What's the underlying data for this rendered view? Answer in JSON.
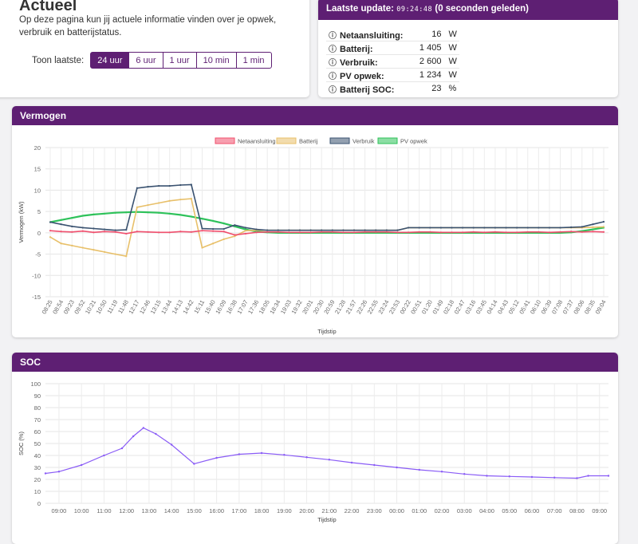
{
  "actueel": {
    "title": "Actueel",
    "intro": "Op deze pagina kun jij actuele informatie vinden over je opwek, verbruik en batterijstatus.",
    "toon_label": "Toon laatste:",
    "buttons": [
      {
        "label": "24 uur",
        "active": true
      },
      {
        "label": "6 uur",
        "active": false
      },
      {
        "label": "1 uur",
        "active": false
      },
      {
        "label": "10 min",
        "active": false
      },
      {
        "label": "1 min",
        "active": false
      }
    ]
  },
  "update": {
    "label": "Laatste update:",
    "time": "09:24:48",
    "ago": "(0 seconden geleden)",
    "rows": [
      {
        "label": "Netaansluiting:",
        "value": "16",
        "unit": "W"
      },
      {
        "label": "Batterij:",
        "value": "1 405",
        "unit": "W"
      },
      {
        "label": "Verbruik:",
        "value": "2 600",
        "unit": "W"
      },
      {
        "label": "PV opwek:",
        "value": "1 234",
        "unit": "W"
      },
      {
        "label": "Batterij SOC:",
        "value": "23",
        "unit": "%"
      }
    ]
  },
  "colors": {
    "accent": "#5e1f73",
    "netaansluiting": "#f0506e",
    "batterij": "#e8c06a",
    "verbruik": "#3a5270",
    "pv": "#2ec25a",
    "soc": "#8a5cf6"
  },
  "chart_data": [
    {
      "type": "line",
      "title": "Vermogen",
      "xlabel": "Tijdstip",
      "ylabel": "Vermogen (kW)",
      "ylim": [
        -15,
        20
      ],
      "yticks": [
        -15,
        -10,
        -5,
        0,
        5,
        10,
        15,
        20
      ],
      "grid": true,
      "legend_position": "top",
      "x": [
        "08:25",
        "08:54",
        "09:23",
        "09:52",
        "10:21",
        "10:50",
        "11:19",
        "11:48",
        "12:17",
        "12:46",
        "13:15",
        "13:44",
        "14:13",
        "14:42",
        "15:11",
        "15:40",
        "16:09",
        "16:38",
        "17:07",
        "17:36",
        "18:05",
        "18:34",
        "19:03",
        "19:32",
        "20:01",
        "20:30",
        "20:59",
        "21:28",
        "21:57",
        "22:26",
        "22:55",
        "23:24",
        "23:53",
        "00:22",
        "00:51",
        "01:20",
        "01:49",
        "02:18",
        "02:47",
        "03:16",
        "03:45",
        "04:14",
        "04:43",
        "05:12",
        "05:41",
        "06:10",
        "06:39",
        "07:08",
        "07:37",
        "08:06",
        "08:35",
        "09:04"
      ],
      "series": [
        {
          "name": "Netaansluiting",
          "values": [
            0.5,
            0.3,
            0.2,
            0.4,
            0.1,
            0.3,
            0.2,
            -0.2,
            0.3,
            0.2,
            0.1,
            0.1,
            0.3,
            0.2,
            0.5,
            0.4,
            0.3,
            -0.5,
            -0.2,
            0.1,
            0.2,
            0.2,
            0.1,
            0.1,
            0.1,
            0.2,
            0.2,
            0.1,
            0.1,
            0.2,
            0.2,
            0.2,
            0.1,
            0.1,
            0.2,
            0.2,
            0.1,
            0.1,
            0.1,
            0.2,
            0.1,
            0.2,
            0.1,
            0.1,
            0.2,
            0.2,
            0.1,
            0.2,
            0.3,
            0.2,
            0.3,
            0.2
          ]
        },
        {
          "name": "Batterij",
          "values": [
            -1.0,
            -2.5,
            -3.0,
            -3.5,
            -4.0,
            -4.5,
            -5.0,
            -5.5,
            6.0,
            6.5,
            7.0,
            7.5,
            7.8,
            8.0,
            -3.5,
            -2.5,
            -1.5,
            -0.8,
            0.5,
            0.6,
            0.6,
            0.6,
            0.6,
            0.6,
            0.6,
            0.6,
            0.6,
            0.6,
            0.6,
            0.6,
            0.6,
            0.6,
            0.6,
            1.2,
            1.2,
            1.2,
            1.2,
            1.2,
            1.2,
            1.2,
            1.2,
            1.2,
            1.2,
            1.2,
            1.2,
            1.2,
            1.2,
            1.2,
            1.2,
            1.2,
            1.3,
            1.4
          ]
        },
        {
          "name": "Verbruik",
          "values": [
            2.5,
            2.0,
            1.5,
            1.2,
            1.0,
            0.8,
            0.6,
            0.7,
            10.5,
            10.8,
            11.0,
            11.0,
            11.2,
            11.3,
            1.0,
            0.9,
            0.9,
            1.8,
            1.2,
            0.8,
            0.6,
            0.6,
            0.6,
            0.6,
            0.6,
            0.6,
            0.6,
            0.6,
            0.6,
            0.6,
            0.6,
            0.6,
            0.6,
            1.2,
            1.2,
            1.2,
            1.2,
            1.2,
            1.2,
            1.2,
            1.2,
            1.2,
            1.2,
            1.2,
            1.2,
            1.2,
            1.2,
            1.2,
            1.3,
            1.4,
            2.0,
            2.6
          ]
        },
        {
          "name": "PV opwek",
          "values": [
            2.5,
            3.0,
            3.5,
            4.0,
            4.3,
            4.5,
            4.7,
            4.8,
            4.9,
            4.8,
            4.7,
            4.5,
            4.2,
            3.8,
            3.3,
            2.8,
            2.2,
            1.5,
            0.8,
            0.3,
            0.1,
            0,
            0,
            0,
            0,
            0,
            0,
            0,
            0,
            0,
            0,
            0,
            0,
            0,
            0,
            0,
            0,
            0,
            0,
            0,
            0,
            0,
            0,
            0,
            0,
            0,
            0,
            0,
            0.1,
            0.4,
            0.8,
            1.2
          ]
        }
      ]
    },
    {
      "type": "line",
      "title": "SOC",
      "xlabel": "Tijdstip",
      "ylabel": "SOC (%)",
      "ylim": [
        0,
        100
      ],
      "yticks": [
        0,
        10,
        20,
        30,
        40,
        50,
        60,
        70,
        80,
        90,
        100
      ],
      "grid": true,
      "x": [
        "09:00",
        "10:00",
        "11:00",
        "12:00",
        "13:00",
        "14:00",
        "15:00",
        "16:00",
        "17:00",
        "18:00",
        "19:00",
        "20:00",
        "21:00",
        "22:00",
        "23:00",
        "00:00",
        "01:00",
        "02:00",
        "03:00",
        "04:00",
        "05:00",
        "06:00",
        "07:00",
        "08:00",
        "09:00"
      ],
      "series": [
        {
          "name": "SOC",
          "points": [
            [
              8.4,
              25
            ],
            [
              9,
              26.5
            ],
            [
              10,
              32
            ],
            [
              11,
              40
            ],
            [
              11.8,
              46
            ],
            [
              12.3,
              56
            ],
            [
              12.75,
              63
            ],
            [
              13.3,
              58
            ],
            [
              14,
              49
            ],
            [
              15,
              33
            ],
            [
              16,
              38
            ],
            [
              17,
              41
            ],
            [
              18,
              42
            ],
            [
              19,
              40.5
            ],
            [
              20,
              38.5
            ],
            [
              21,
              36.5
            ],
            [
              22,
              34
            ],
            [
              23,
              32
            ],
            [
              24,
              30
            ],
            [
              25,
              28
            ],
            [
              26,
              26.5
            ],
            [
              27,
              24.5
            ],
            [
              28,
              23
            ],
            [
              29,
              22.5
            ],
            [
              30,
              22
            ],
            [
              31,
              21.5
            ],
            [
              32,
              21
            ],
            [
              32.5,
              23
            ],
            [
              33.4,
              23
            ]
          ]
        }
      ]
    }
  ],
  "vermogen_title": "Vermogen",
  "soc_title": "SOC"
}
